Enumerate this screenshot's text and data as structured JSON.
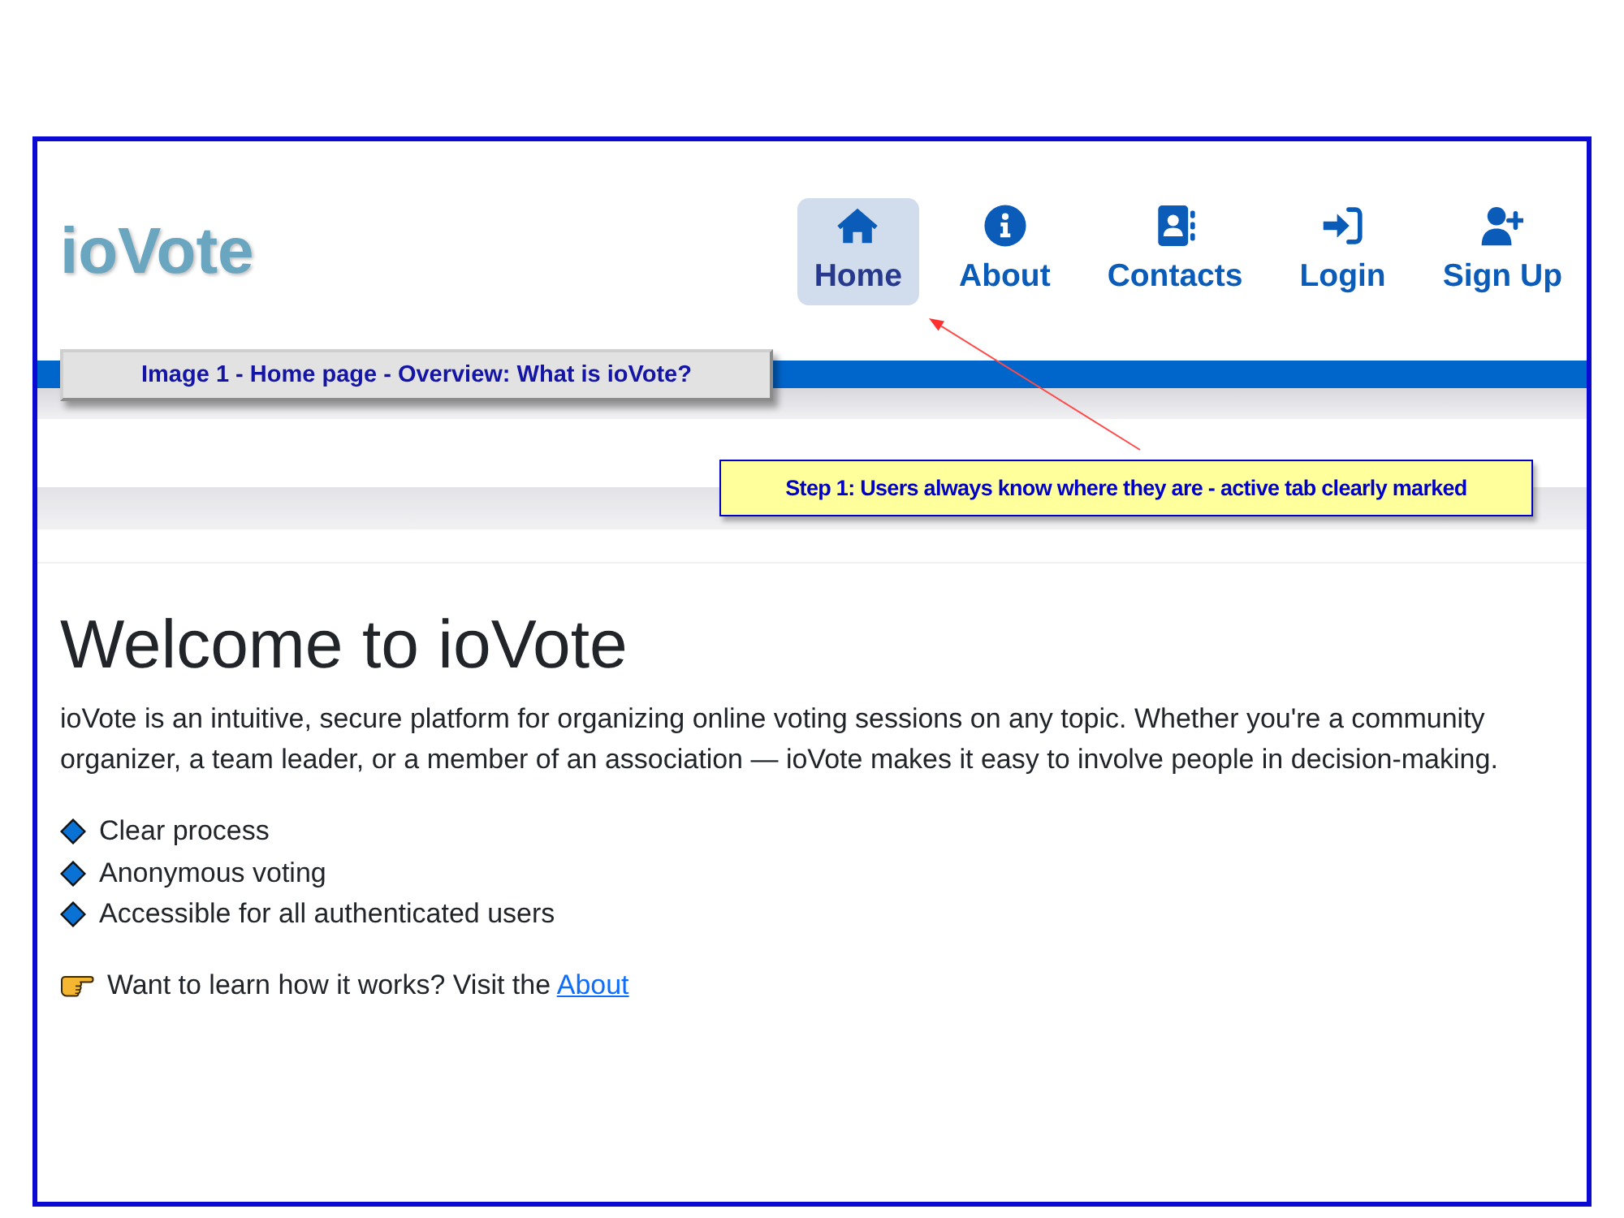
{
  "logo": "ioVote",
  "nav": {
    "items": [
      {
        "label": "Home",
        "selected": true
      },
      {
        "label": "About",
        "selected": false
      },
      {
        "label": "Contacts",
        "selected": false
      },
      {
        "label": "Login",
        "selected": false
      },
      {
        "label": "Sign Up",
        "selected": false
      }
    ]
  },
  "content": {
    "heading": "Welcome to ioVote",
    "intro": "ioVote is an intuitive, secure platform for organizing online voting sessions on any topic. Whether you're a community organizer, a team leader, or a member of an association — ioVote makes it easy to involve people in decision-making.",
    "features": [
      "Clear process",
      "Anonymous voting",
      "Accessible for all authenticated users"
    ],
    "learn_more": {
      "text": "Want to learn how it works? Visit the",
      "link": "About"
    }
  },
  "annotations": [
    {
      "kind": "caption",
      "text": "Image 1 - Home page - Overview: What is ioVote?"
    },
    {
      "kind": "callout",
      "text": "Step 1: Users always know where they are - active tab clearly marked"
    }
  ]
}
